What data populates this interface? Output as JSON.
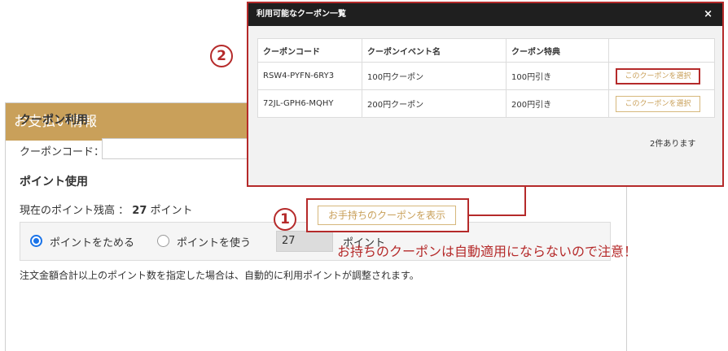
{
  "payment": {
    "header": "お支払い情報",
    "coupon_section_title": "クーポン利用",
    "coupon_code_label": "クーポンコード：",
    "coupon_code_value": "",
    "show_coupons_button": "お手持ちのクーポンを表示",
    "point_section_title": "ポイント使用",
    "balance_label": "現在のポイント残高 ：",
    "balance_value": "27",
    "balance_unit": "ポイント",
    "radio_save_label": "ポイントをためる",
    "radio_use_label": "ポイントを使う",
    "points_value": "27",
    "points_unit": "ポイント",
    "note": "注文金額合計以上のポイント数を指定した場合は、自動的に利用ポイントが調整されます。"
  },
  "markers": {
    "one": "1",
    "two": "2"
  },
  "warning": "お持ちのクーポンは自動適用にならないので注意！",
  "modal": {
    "title": "利用可能なクーポン一覧",
    "close": "×",
    "columns": [
      "クーポンコード",
      "クーポンイベント名",
      "クーポン特典",
      ""
    ],
    "rows": [
      {
        "code": "RSW4-PYFN-6RY3",
        "event": "100円クーポン",
        "benefit": "100円引き",
        "action": "このクーポンを選択"
      },
      {
        "code": "72JL-GPH6-MQHY",
        "event": "200円クーポン",
        "benefit": "200円引き",
        "action": "このクーポンを選択"
      }
    ],
    "count": "2件あります"
  },
  "colors": {
    "gold": "#c9a05a",
    "red": "#b52a2a",
    "radio": "#1a73e8"
  }
}
